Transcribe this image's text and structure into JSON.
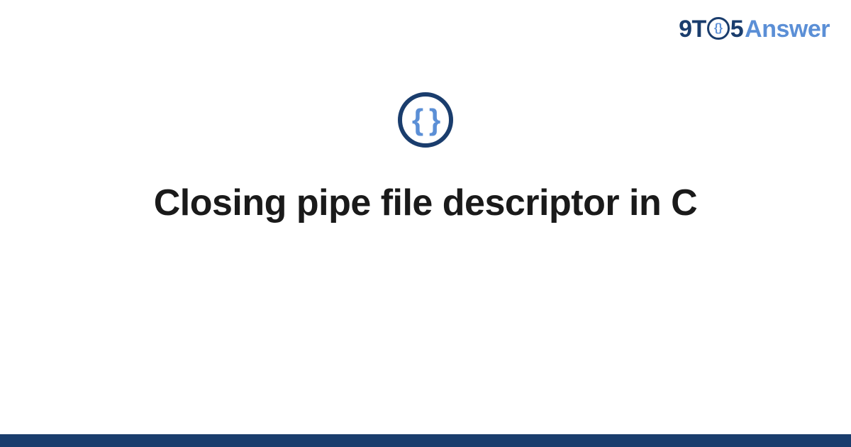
{
  "header": {
    "logo": {
      "prefix": "9T",
      "clock_inner": "{}",
      "middle": "5",
      "suffix": "Answer"
    }
  },
  "main": {
    "icon_braces": "{ }",
    "title": "Closing pipe file descriptor in C"
  },
  "colors": {
    "primary_dark": "#1a3d6d",
    "primary_light": "#5b8fd6",
    "text": "#1a1a1a"
  }
}
